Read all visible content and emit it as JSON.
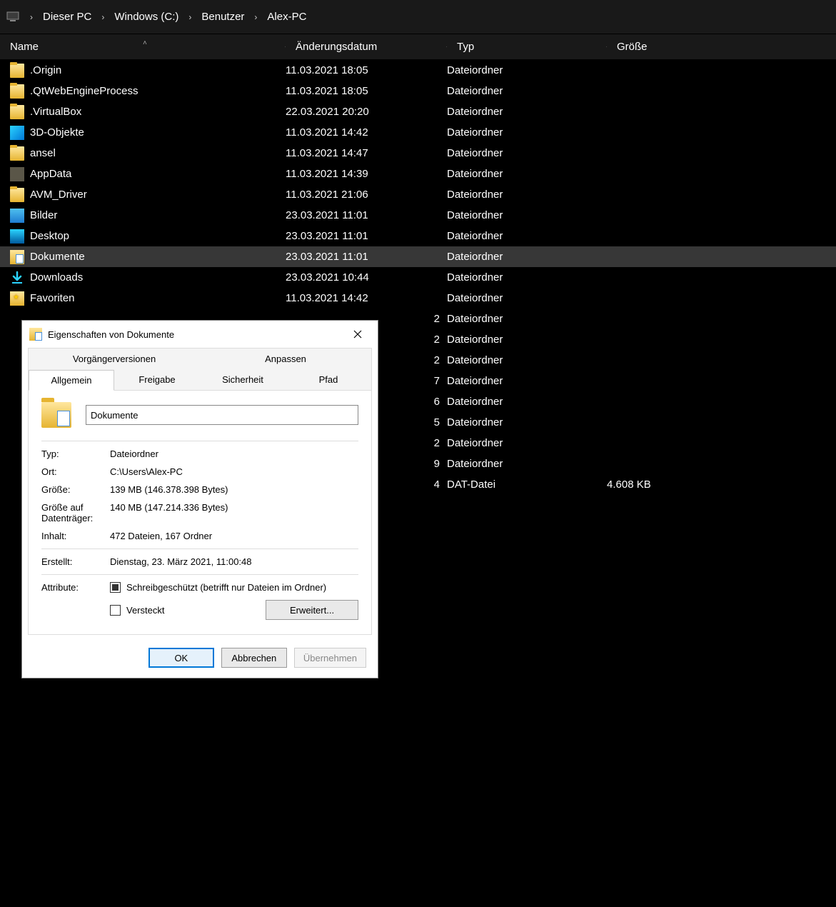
{
  "breadcrumb": [
    "Dieser PC",
    "Windows (C:)",
    "Benutzer",
    "Alex-PC"
  ],
  "columns": {
    "name": "Name",
    "date": "Änderungsdatum",
    "type": "Typ",
    "size": "Größe"
  },
  "rows": [
    {
      "icon": "folder",
      "name": ".Origin",
      "date": "11.03.2021 18:05",
      "type": "Dateiordner",
      "size": ""
    },
    {
      "icon": "folder",
      "name": ".QtWebEngineProcess",
      "date": "11.03.2021 18:05",
      "type": "Dateiordner",
      "size": ""
    },
    {
      "icon": "folder",
      "name": ".VirtualBox",
      "date": "22.03.2021 20:20",
      "type": "Dateiordner",
      "size": ""
    },
    {
      "icon": "3d",
      "name": "3D-Objekte",
      "date": "11.03.2021 14:42",
      "type": "Dateiordner",
      "size": ""
    },
    {
      "icon": "folder",
      "name": "ansel",
      "date": "11.03.2021 14:47",
      "type": "Dateiordner",
      "size": ""
    },
    {
      "icon": "appdata",
      "name": "AppData",
      "date": "11.03.2021 14:39",
      "type": "Dateiordner",
      "size": ""
    },
    {
      "icon": "folder",
      "name": "AVM_Driver",
      "date": "11.03.2021 21:06",
      "type": "Dateiordner",
      "size": ""
    },
    {
      "icon": "pictures",
      "name": "Bilder",
      "date": "23.03.2021 11:01",
      "type": "Dateiordner",
      "size": ""
    },
    {
      "icon": "desktop",
      "name": "Desktop",
      "date": "23.03.2021 11:01",
      "type": "Dateiordner",
      "size": ""
    },
    {
      "icon": "docs",
      "name": "Dokumente",
      "date": "23.03.2021 11:01",
      "type": "Dateiordner",
      "size": "",
      "selected": true
    },
    {
      "icon": "downloads",
      "name": "Downloads",
      "date": "23.03.2021 10:44",
      "type": "Dateiordner",
      "size": ""
    },
    {
      "icon": "fav",
      "name": "Favoriten",
      "date": "11.03.2021 14:42",
      "type": "Dateiordner",
      "size": ""
    },
    {
      "icon": "hidden",
      "name": "",
      "date": "2",
      "type": "Dateiordner",
      "size": ""
    },
    {
      "icon": "hidden",
      "name": "",
      "date": "2",
      "type": "Dateiordner",
      "size": ""
    },
    {
      "icon": "hidden",
      "name": "",
      "date": "2",
      "type": "Dateiordner",
      "size": ""
    },
    {
      "icon": "hidden",
      "name": "",
      "date": "7",
      "type": "Dateiordner",
      "size": ""
    },
    {
      "icon": "hidden",
      "name": "",
      "date": "6",
      "type": "Dateiordner",
      "size": ""
    },
    {
      "icon": "hidden",
      "name": "",
      "date": "5",
      "type": "Dateiordner",
      "size": ""
    },
    {
      "icon": "hidden",
      "name": "",
      "date": "2",
      "type": "Dateiordner",
      "size": ""
    },
    {
      "icon": "hidden",
      "name": "",
      "date": "9",
      "type": "Dateiordner",
      "size": ""
    },
    {
      "icon": "hidden",
      "name": "",
      "date": "4",
      "type": "DAT-Datei",
      "size": "4.608 KB"
    }
  ],
  "dialog": {
    "title": "Eigenschaften von Dokumente",
    "tabs_top": [
      "Vorgängerversionen",
      "Anpassen"
    ],
    "tabs_bottom": [
      "Allgemein",
      "Freigabe",
      "Sicherheit",
      "Pfad"
    ],
    "active_tab": "Allgemein",
    "name_value": "Dokumente",
    "rows": {
      "typ_label": "Typ:",
      "typ_value": "Dateiordner",
      "ort_label": "Ort:",
      "ort_value": "C:\\Users\\Alex-PC",
      "groesse_label": "Größe:",
      "groesse_value": "139 MB (146.378.398 Bytes)",
      "disk_label": "Größe auf Datenträger:",
      "disk_value": "140 MB (147.214.336 Bytes)",
      "inhalt_label": "Inhalt:",
      "inhalt_value": "472 Dateien, 167 Ordner",
      "erstellt_label": "Erstellt:",
      "erstellt_value": "Dienstag, 23. März 2021, 11:00:48",
      "attr_label": "Attribute:",
      "readonly_label": "Schreibgeschützt (betrifft nur Dateien im Ordner)",
      "hidden_label": "Versteckt",
      "erweitert_label": "Erweitert..."
    },
    "buttons": {
      "ok": "OK",
      "cancel": "Abbrechen",
      "apply": "Übernehmen"
    }
  }
}
